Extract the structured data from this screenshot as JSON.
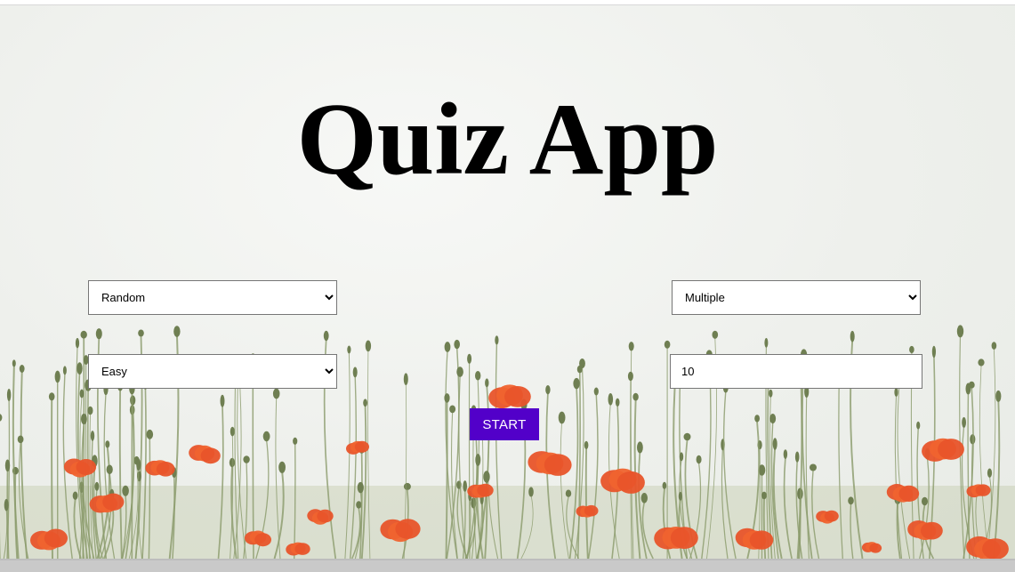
{
  "app": {
    "title": "Quiz App"
  },
  "form": {
    "category": {
      "selected": "Random",
      "options": [
        "Random"
      ]
    },
    "type": {
      "selected": "Multiple",
      "options": [
        "Multiple"
      ]
    },
    "difficulty": {
      "selected": "Easy",
      "options": [
        "Easy"
      ]
    },
    "amount": {
      "value": "10"
    },
    "start_label": "START"
  },
  "colors": {
    "accent": "#5200c9",
    "poppy": "#e8542a",
    "stem": "#8a9a6a"
  }
}
